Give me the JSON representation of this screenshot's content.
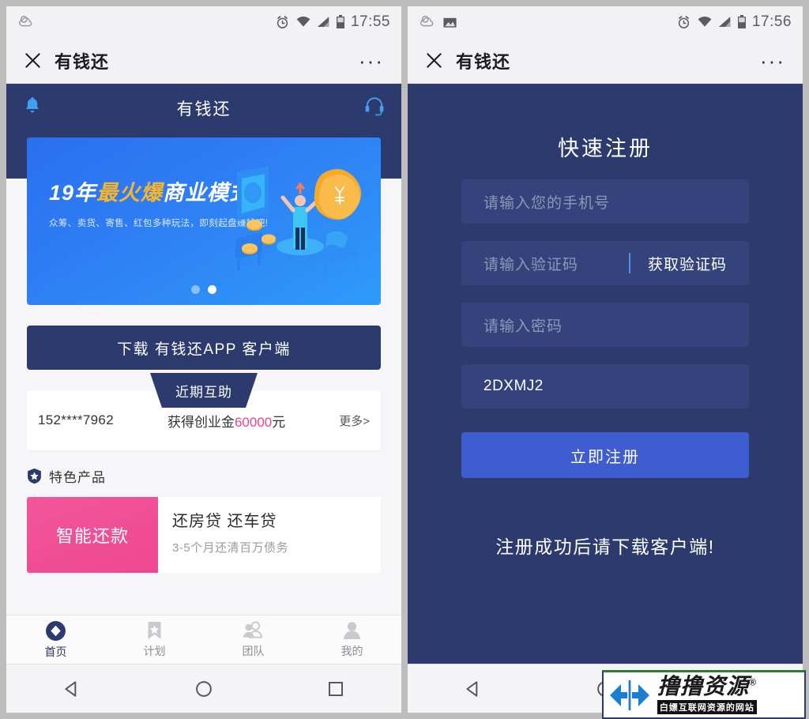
{
  "left_phone": {
    "statusbar": {
      "time": "17:55",
      "icons": [
        "weather-cloud-icon",
        "alarm-icon",
        "wifi-icon",
        "signal-icon",
        "battery-icon"
      ]
    },
    "titlebar": {
      "close_icon": "close-icon",
      "title": "有钱还",
      "menu": "···"
    },
    "app_header": {
      "title": "有钱还",
      "bell_icon": "bell-icon",
      "support_icon": "headset-icon"
    },
    "banner": {
      "title_prefix": "19年",
      "title_highlight": "最火爆",
      "title_suffix": "商业模式",
      "subtitle": "众筹、卖货、寄售、红包多种玩法，即刻起盘赚钱吧!",
      "dots": 2,
      "active_dot": 2
    },
    "download_button": "下载  有钱还APP  客户端",
    "recent_help": {
      "tag": "近期互助",
      "phone": "152****7962",
      "text_prefix": "获得创业金",
      "amount": "60000",
      "text_suffix": "元",
      "more": "更多>"
    },
    "feature": {
      "heading": "特色产品",
      "heading_icon": "shield-star-icon",
      "product": {
        "badge": "智能还款",
        "title": "还房贷 还车贷",
        "desc": "3-5个月还清百万债务"
      }
    },
    "tabs": [
      {
        "label": "首页",
        "icon": "home-diamond-icon",
        "active": true
      },
      {
        "label": "计划",
        "icon": "bookmark-star-icon",
        "active": false
      },
      {
        "label": "团队",
        "icon": "team-icon",
        "active": false
      },
      {
        "label": "我的",
        "icon": "person-icon",
        "active": false
      }
    ],
    "navbar": [
      "back-triangle-icon",
      "home-circle-icon",
      "recents-square-icon"
    ]
  },
  "right_phone": {
    "statusbar": {
      "time": "17:56",
      "icons": [
        "weather-cloud-icon",
        "image-icon",
        "alarm-icon",
        "wifi-icon",
        "signal-icon",
        "battery-icon"
      ]
    },
    "titlebar": {
      "close_icon": "close-icon",
      "title": "有钱还",
      "menu": "···"
    },
    "register": {
      "title": "快速注册",
      "fields": [
        {
          "name": "phone",
          "placeholder": "请输入您的手机号",
          "value": ""
        },
        {
          "name": "sms-code",
          "placeholder": "请输入验证码",
          "value": "",
          "action": "获取验证码"
        },
        {
          "name": "password",
          "placeholder": "请输入密码",
          "value": ""
        },
        {
          "name": "invite-code",
          "placeholder": "",
          "value": "2DXMJ2"
        }
      ],
      "submit": "立即注册",
      "note": "注册成功后请下载客户端!"
    },
    "navbar": [
      "back-triangle-icon",
      "home-circle-icon",
      "recents-square-icon"
    ]
  },
  "watermark": {
    "main": "撸撸资源",
    "reg": "®",
    "sub": "白嫖互联网资源的网站"
  },
  "colors": {
    "navy": "#2d3a6e",
    "field": "#34437b",
    "submit_blue": "#3f5cd0",
    "banner_blue": "#2a6ff0",
    "accent_orange": "#f5b52c",
    "pink": "#f0428a",
    "page_bg": "#bdbdbd"
  }
}
